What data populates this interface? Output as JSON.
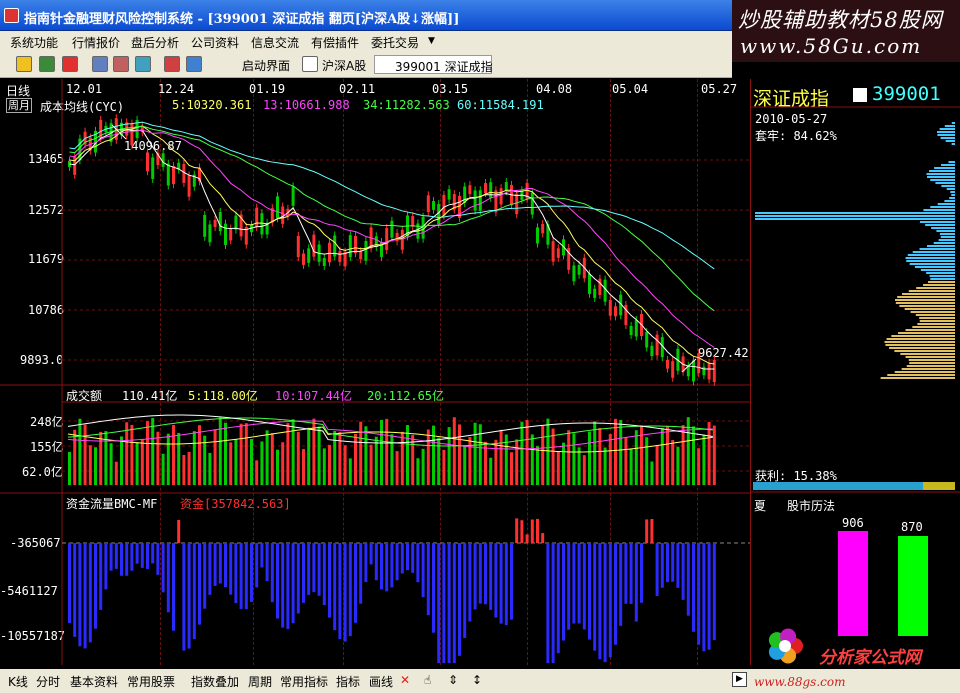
{
  "window": {
    "title": "指南针金融理财风险控制系统 - [399001 深证成指 翻页[沪深A股↓涨幅]]"
  },
  "watermark_top": {
    "line1": "炒股辅助教材58股网",
    "line2": "www.58Gu.com"
  },
  "menu": [
    "系统功能",
    "行情报价",
    "盘后分析",
    "公司资料",
    "信息交流",
    "有偿插件",
    "委托交易"
  ],
  "toolbar": {
    "start_label": "启动界面",
    "market_label": "沪深A股",
    "code_label": "399001 深证成指"
  },
  "main_chart": {
    "period": "日线",
    "mode": "周月",
    "indicator_name": "成本均线(CYC)",
    "dates": [
      "12.01",
      "12.24",
      "01.19",
      "02.11",
      "03.15",
      "04.08",
      "05.04",
      "05.27"
    ],
    "ma_labels": [
      {
        "text": "5:10320.361",
        "color": "#ffff66"
      },
      {
        "text": "13:10661.988",
        "color": "#ff44ff"
      },
      {
        "text": "34:11282.563",
        "color": "#44ff44"
      },
      {
        "text": "60:11584.191",
        "color": "#66ffff"
      }
    ],
    "y_ticks": [
      "13465",
      "12572",
      "11679",
      "10786",
      "9893.0"
    ],
    "high_annot": "14096.87",
    "low_annot": "9627.42"
  },
  "volume": {
    "title": "成交额",
    "current": "110.41亿",
    "ma": [
      {
        "text": "5:118.00亿",
        "color": "#ffff66"
      },
      {
        "text": "10:107.44亿",
        "color": "#ff44ff"
      },
      {
        "text": "20:112.65亿",
        "color": "#44ff44"
      }
    ],
    "y_ticks": [
      "248亿",
      "155亿",
      "62.0亿"
    ]
  },
  "money_flow": {
    "title": "资金流量BMC-MF",
    "value_label": "资金[357842.563]",
    "y_ticks": [
      "-365067",
      "-5461127",
      "-10557187"
    ]
  },
  "right_panel": {
    "name": "深证成指",
    "code": "399001",
    "date": "2010-05-27",
    "trapped": "套牢: 84.62%",
    "profit": "获利: 15.38%",
    "calendar_tab1": "夏",
    "calendar_tab2": "股市历法",
    "bar1_value": "906",
    "bar2_value": "870",
    "bar1_color": "#ff00ff",
    "bar2_color": "#00ff00",
    "logo_text": "分析家公式网",
    "logo_url": "www.88gs.com"
  },
  "bottombar": {
    "items": [
      "K线",
      "分时",
      "基本资料",
      "常用股票",
      "指数叠加",
      "周期",
      "常用指标",
      "指标",
      "画线"
    ]
  },
  "colors": {
    "up": "#ff3030",
    "down": "#00cc00",
    "neg": "#2a2aff",
    "grid": "#6a1010"
  }
}
